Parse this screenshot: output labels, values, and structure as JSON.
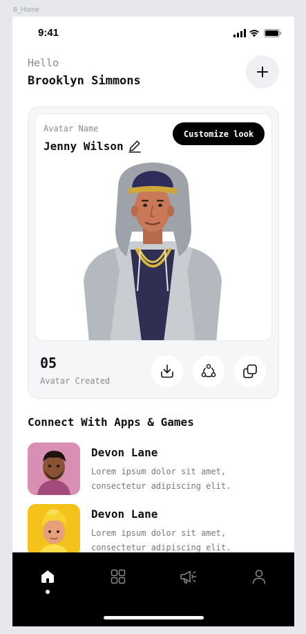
{
  "frame_label": "8_Home",
  "status_bar": {
    "time": "9:41",
    "icons": [
      "signal-icon",
      "wifi-icon",
      "battery-icon"
    ]
  },
  "greeting": {
    "hello": "Hello",
    "user_name": "Brooklyn Simmons",
    "add_icon": "plus-icon"
  },
  "avatar_card": {
    "label": "Avatar Name",
    "name": "Jenny Wilson",
    "edit_icon": "pencil-icon",
    "customize_label": "Customize look",
    "count": "05",
    "count_label": "Avatar Created",
    "actions": [
      "download-icon",
      "share-icon",
      "copy-icon"
    ]
  },
  "connect": {
    "title": "Connect With Apps & Games",
    "items": [
      {
        "title": "Devon Lane",
        "description": "Lorem ipsum dolor sit amet, consectetur adipiscing elit."
      },
      {
        "title": "Devon Lane",
        "description": "Lorem ipsum dolor sit amet, consectetur adipiscing elit."
      }
    ]
  },
  "nav": {
    "items": [
      "home-icon",
      "grid-icon",
      "megaphone-icon",
      "profile-icon"
    ],
    "active": "home-icon"
  },
  "colors": {
    "accent": "#000000",
    "surface": "#f5f6f8",
    "muted_text": "#8a8a8a",
    "thumb_pink": "#d98fb4",
    "thumb_yellow": "#f4c21b"
  }
}
